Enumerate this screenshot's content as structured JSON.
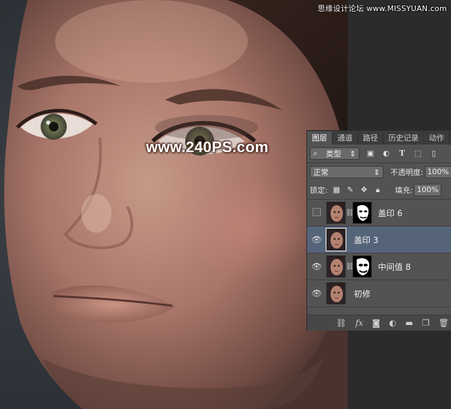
{
  "watermarks": {
    "top": "思缘设计论坛 www.MISSYUAN.com",
    "center": "www.240PS.com"
  },
  "layers_panel": {
    "tabs": [
      {
        "label": "图层",
        "active": true
      },
      {
        "label": "通道",
        "active": false
      },
      {
        "label": "路径",
        "active": false
      },
      {
        "label": "历史记录",
        "active": false
      },
      {
        "label": "动作",
        "active": false
      }
    ],
    "filter": {
      "label": "类型",
      "icon": "search-icon"
    },
    "blend_mode": "正常",
    "opacity_label": "不透明度:",
    "opacity_value": "100%",
    "lock_label": "锁定:",
    "fill_label": "填充:",
    "fill_value": "100%",
    "layers": [
      {
        "name": "盖印",
        "number": "6",
        "visible": false,
        "has_mask": true,
        "selected": false
      },
      {
        "name": "盖印",
        "number": "3",
        "visible": true,
        "has_mask": false,
        "selected": true
      },
      {
        "name": "中间值",
        "number": "8",
        "visible": true,
        "has_mask": true,
        "selected": false
      },
      {
        "name": "初修",
        "number": "",
        "visible": true,
        "has_mask": false,
        "selected": false
      }
    ],
    "footer_icons": [
      "link-icon",
      "fx-icon",
      "mask-icon",
      "adjustment-icon",
      "folder-icon",
      "new-layer-icon",
      "trash-icon"
    ]
  },
  "colors": {
    "panel_bg": "#535353",
    "tab_bar_bg": "#3c3c3c",
    "selected_layer": "#56647a",
    "canvas_bg": "#2a2a2a"
  }
}
